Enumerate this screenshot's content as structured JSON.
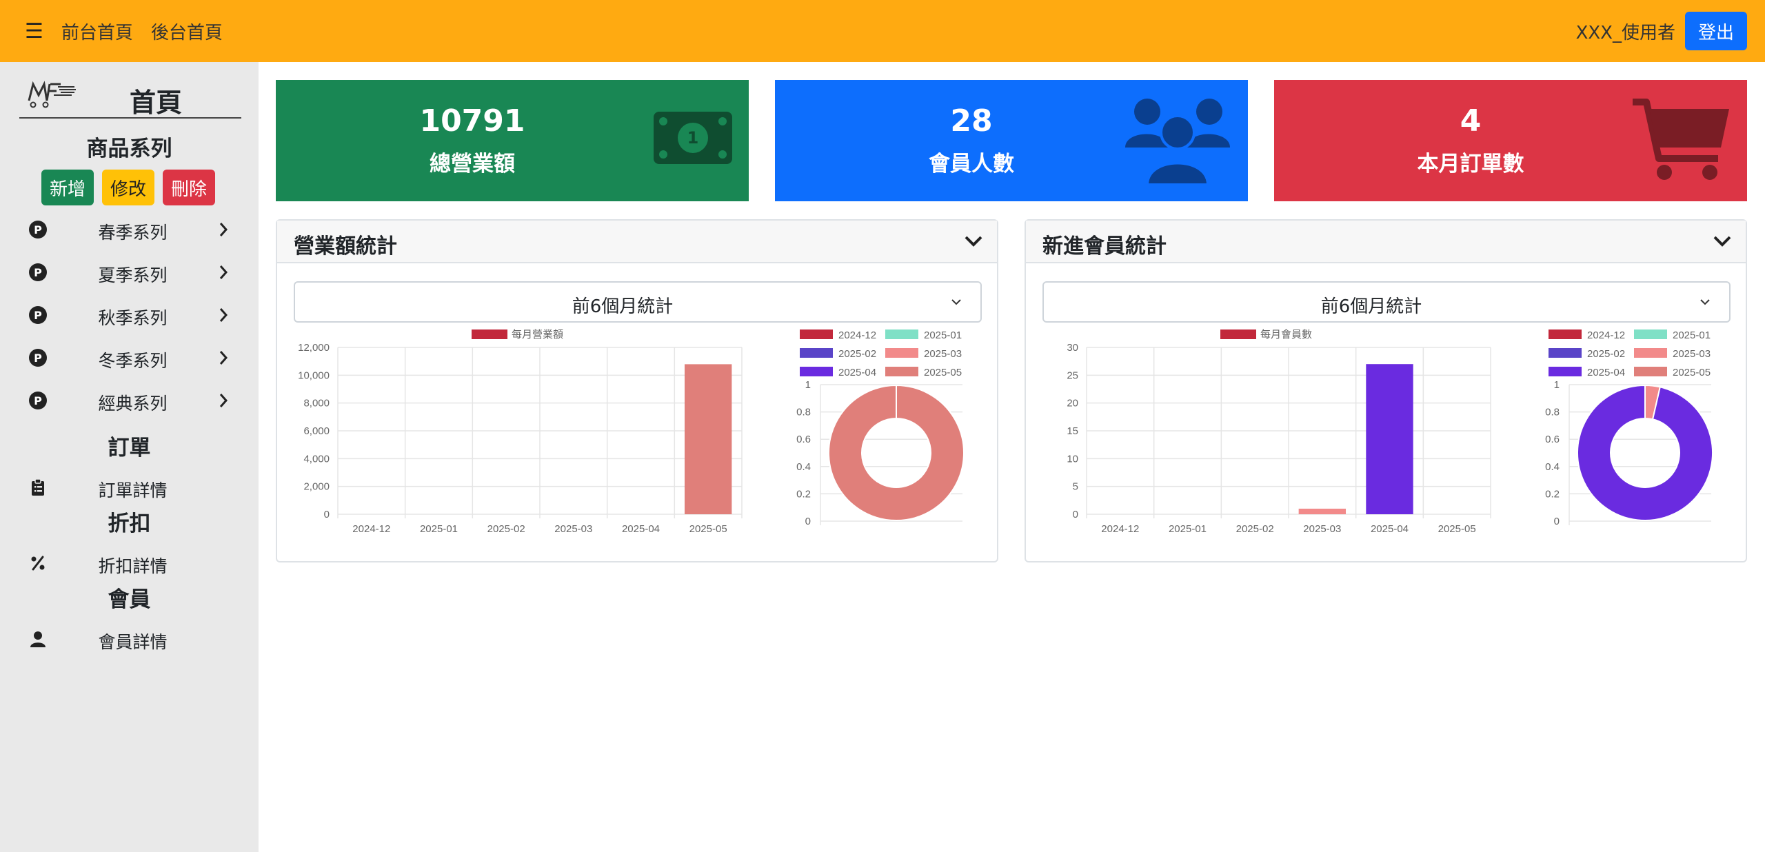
{
  "header": {
    "menu_icon": "hamburger-icon",
    "links": [
      "前台首頁",
      "後台首頁"
    ],
    "username": "XXX_使用者",
    "logout_label": "登出",
    "bg_color": "#ffaa11",
    "logout_color": "#0d6efd"
  },
  "sidebar": {
    "title": "首頁",
    "logo_text": "MF",
    "product_section": "商品系列",
    "buttons": {
      "add": "新增",
      "edit": "修改",
      "delete": "刪除"
    },
    "series": [
      {
        "label": "春季系列",
        "icon": "p-circle-icon"
      },
      {
        "label": "夏季系列",
        "icon": "p-circle-icon"
      },
      {
        "label": "秋季系列",
        "icon": "p-circle-icon"
      },
      {
        "label": "冬季系列",
        "icon": "p-circle-icon"
      },
      {
        "label": "經典系列",
        "icon": "p-circle-icon"
      }
    ],
    "order_section": "訂單",
    "order_item": "訂單詳情",
    "discount_section": "折扣",
    "discount_item": "折扣詳情",
    "member_section": "會員",
    "member_item": "會員詳情"
  },
  "cards": [
    {
      "value": "10791",
      "label": "總營業額",
      "color": "#198754",
      "icon": "money-bill-icon"
    },
    {
      "value": "28",
      "label": "會員人數",
      "color": "#0d6efd",
      "icon": "users-icon"
    },
    {
      "value": "4",
      "label": "本月訂單數",
      "color": "#dc3545",
      "icon": "cart-icon"
    }
  ],
  "panels": {
    "revenue": {
      "title": "營業額統計",
      "select_value": "前6個月統計"
    },
    "members": {
      "title": "新進會員統計",
      "select_value": "前6個月統計"
    }
  },
  "chart_data": [
    {
      "type": "bar",
      "categories": [
        "2024-12",
        "2025-01",
        "2025-02",
        "2025-03",
        "2025-04",
        "2025-05"
      ],
      "series": [
        {
          "name": "每月營業額",
          "values": [
            0,
            0,
            0,
            0,
            0,
            10791
          ]
        }
      ],
      "colors": [
        "#c2283b",
        "#7fe0c6",
        "#5a44c8",
        "#f28a8a",
        "#6a2be0",
        "#e07f7a"
      ],
      "legend_color": "#c2283b",
      "ylim": [
        0,
        12000
      ],
      "yticks": [
        "0",
        "2,000",
        "4,000",
        "6,000",
        "8,000",
        "10,000",
        "12,000"
      ],
      "grid": true,
      "legend": "top"
    },
    {
      "type": "pie",
      "categories": [
        "2024-12",
        "2025-01",
        "2025-02",
        "2025-03",
        "2025-04",
        "2025-05"
      ],
      "values": [
        0,
        0,
        0,
        0,
        0,
        10791
      ],
      "colors": [
        "#c2283b",
        "#7fe0c6",
        "#5a44c8",
        "#f28a8a",
        "#6a2be0",
        "#e07f7a"
      ],
      "ylim": [
        0,
        1
      ],
      "yticks": [
        "0",
        "0.2",
        "0.4",
        "0.6",
        "0.8",
        "1"
      ],
      "legend": "top"
    },
    {
      "type": "bar",
      "categories": [
        "2024-12",
        "2025-01",
        "2025-02",
        "2025-03",
        "2025-04",
        "2025-05"
      ],
      "series": [
        {
          "name": "每月會員數",
          "values": [
            0,
            0,
            0,
            1,
            27,
            0
          ]
        }
      ],
      "colors": [
        "#c2283b",
        "#7fe0c6",
        "#5a44c8",
        "#f28a8a",
        "#6a2be0",
        "#e07f7a"
      ],
      "legend_color": "#c2283b",
      "ylim": [
        0,
        30
      ],
      "yticks": [
        "0",
        "5",
        "10",
        "15",
        "20",
        "25",
        "30"
      ],
      "grid": true,
      "legend": "top"
    },
    {
      "type": "pie",
      "categories": [
        "2024-12",
        "2025-01",
        "2025-02",
        "2025-03",
        "2025-04",
        "2025-05"
      ],
      "values": [
        0,
        0,
        0,
        1,
        27,
        0
      ],
      "colors": [
        "#c2283b",
        "#7fe0c6",
        "#5a44c8",
        "#f28a8a",
        "#6a2be0",
        "#e07f7a"
      ],
      "ylim": [
        0,
        1
      ],
      "yticks": [
        "0",
        "0.2",
        "0.4",
        "0.6",
        "0.8",
        "1"
      ],
      "legend": "top"
    }
  ]
}
